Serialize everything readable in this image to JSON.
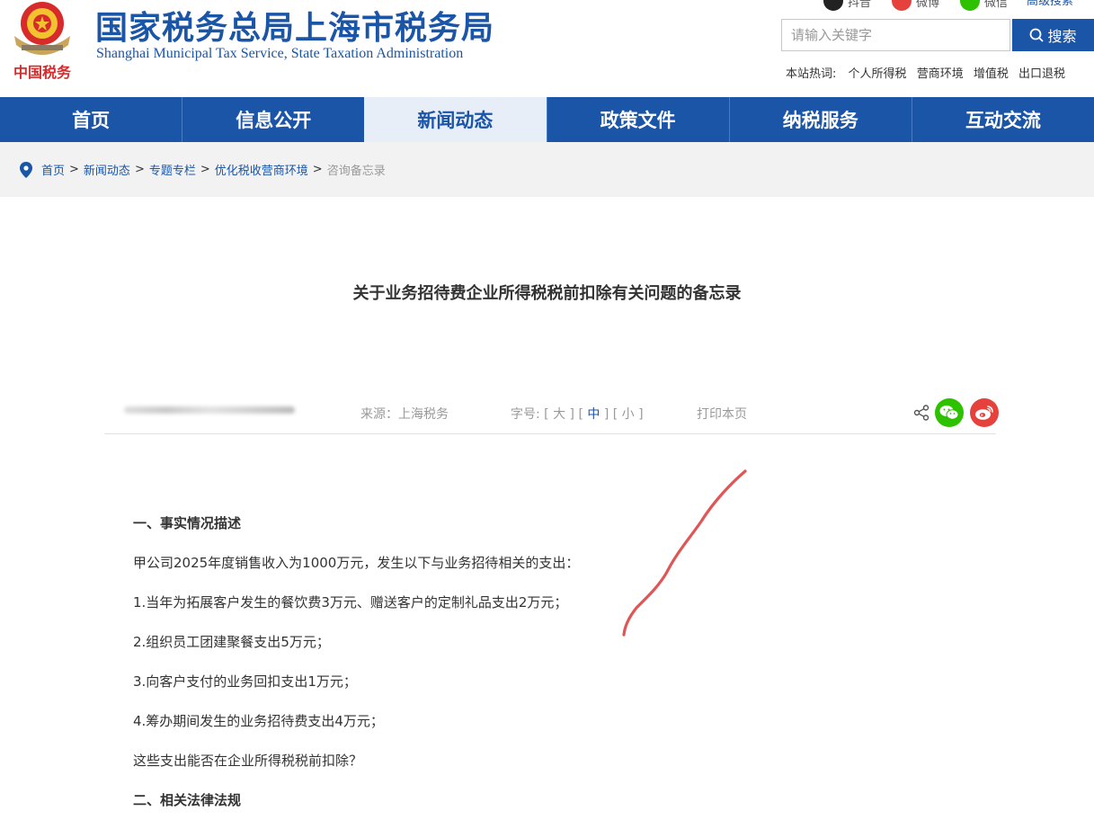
{
  "header": {
    "title": "国家税务总局上海市税务局",
    "subtitle": "Shanghai Municipal Tax Service, State Taxation Administration",
    "emblem_caption": "中国税务",
    "social": [
      {
        "label": "抖音",
        "icon": "douyin-icon",
        "color": "#222222"
      },
      {
        "label": "微博",
        "icon": "weibo-icon",
        "color": "#e6423d"
      },
      {
        "label": "微信",
        "icon": "wechat-icon",
        "color": "#2dc100"
      }
    ],
    "advanced_search": "高级搜索",
    "search": {
      "placeholder": "请输入关键字",
      "button_label": "搜索"
    },
    "hot_label": "本站热词:",
    "hot_words": [
      "个人所得税",
      "营商环境",
      "增值税",
      "出口退税"
    ]
  },
  "nav": {
    "items": [
      "首页",
      "信息公开",
      "新闻动态",
      "政策文件",
      "纳税服务",
      "互动交流"
    ],
    "active_index": 2
  },
  "breadcrumb": {
    "items": [
      "首页",
      "新闻动态",
      "专题专栏",
      "优化税收营商环境"
    ],
    "current": "咨询备忘录",
    "separator": ">"
  },
  "article": {
    "title": "关于业务招待费企业所得税税前扣除有关问题的备忘录",
    "source": "来源：上海税务",
    "font_size_label": "字号:",
    "font_sizes": [
      "大",
      "中",
      "小"
    ],
    "font_size_selected": "中",
    "print_label": "打印本页",
    "paragraphs": [
      {
        "text": "一、事实情况描述",
        "heading": true
      },
      {
        "text": "甲公司2025年度销售收入为1000万元，发生以下与业务招待相关的支出：",
        "heading": false
      },
      {
        "text": "1.当年为拓展客户发生的餐饮费3万元、赠送客户的定制礼品支出2万元；",
        "heading": false
      },
      {
        "text": "2.组织员工团建聚餐支出5万元；",
        "heading": false
      },
      {
        "text": "3.向客户支付的业务回扣支出1万元；",
        "heading": false
      },
      {
        "text": "4.筹办期间发生的业务招待费支出4万元；",
        "heading": false
      },
      {
        "text": "这些支出能否在企业所得税税前扣除？",
        "heading": false
      },
      {
        "text": "二、相关法律法规",
        "heading": true
      }
    ]
  },
  "colors": {
    "brand_blue": "#1a55a8",
    "nav_active_bg": "#e8eef7",
    "breadcrumb_bg": "#f2f2f2",
    "wechat_green": "#2dc100",
    "weibo_red": "#e6423d",
    "annotation_stroke": "#e05555"
  }
}
